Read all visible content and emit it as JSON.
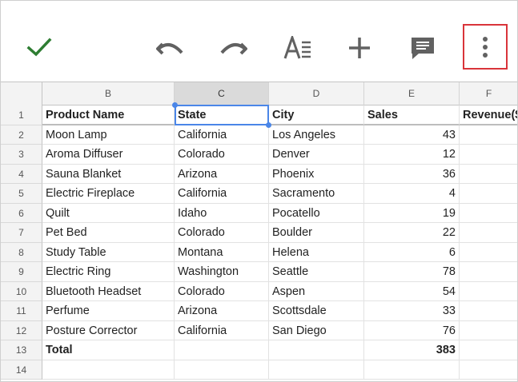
{
  "toolbar": {
    "icons": [
      "check-icon",
      "undo-icon",
      "redo-icon",
      "text-format-icon",
      "add-icon",
      "comment-icon",
      "more-vert-icon"
    ]
  },
  "columns": [
    "B",
    "C",
    "D",
    "E",
    "F"
  ],
  "row_numbers": [
    "1",
    "2",
    "3",
    "4",
    "5",
    "6",
    "7",
    "8",
    "9",
    "10",
    "11",
    "12",
    "13",
    "14"
  ],
  "header": {
    "product": "Product Name",
    "state": "State",
    "city": "City",
    "sales": "Sales",
    "revenue": "Revenue($"
  },
  "rows": [
    {
      "product": "Moon Lamp",
      "state": "California",
      "city": "Los Angeles",
      "sales": "43"
    },
    {
      "product": "Aroma Diffuser",
      "state": "Colorado",
      "city": "Denver",
      "sales": "12"
    },
    {
      "product": "Sauna Blanket",
      "state": "Arizona",
      "city": "Phoenix",
      "sales": "36"
    },
    {
      "product": "Electric Fireplace",
      "state": "California",
      "city": "Sacramento",
      "sales": "4"
    },
    {
      "product": "Quilt",
      "state": "Idaho",
      "city": "Pocatello",
      "sales": "19"
    },
    {
      "product": "Pet Bed",
      "state": "Colorado",
      "city": "Boulder",
      "sales": "22"
    },
    {
      "product": "Study Table",
      "state": "Montana",
      "city": "Helena",
      "sales": "6"
    },
    {
      "product": "Electric Ring",
      "state": "Washington",
      "city": "Seattle",
      "sales": "78"
    },
    {
      "product": "Bluetooth Headset",
      "state": "Colorado",
      "city": "Aspen",
      "sales": "54"
    },
    {
      "product": "Perfume",
      "state": "Arizona",
      "city": "Scottsdale",
      "sales": "33"
    },
    {
      "product": "Posture Corrector",
      "state": "California",
      "city": "San Diego",
      "sales": "76"
    }
  ],
  "total": {
    "label": "Total",
    "sales": "383"
  },
  "colors": {
    "accent": "#4a86e8",
    "check": "#2e7d32",
    "highlight": "#d9343a",
    "icon": "#616161"
  }
}
